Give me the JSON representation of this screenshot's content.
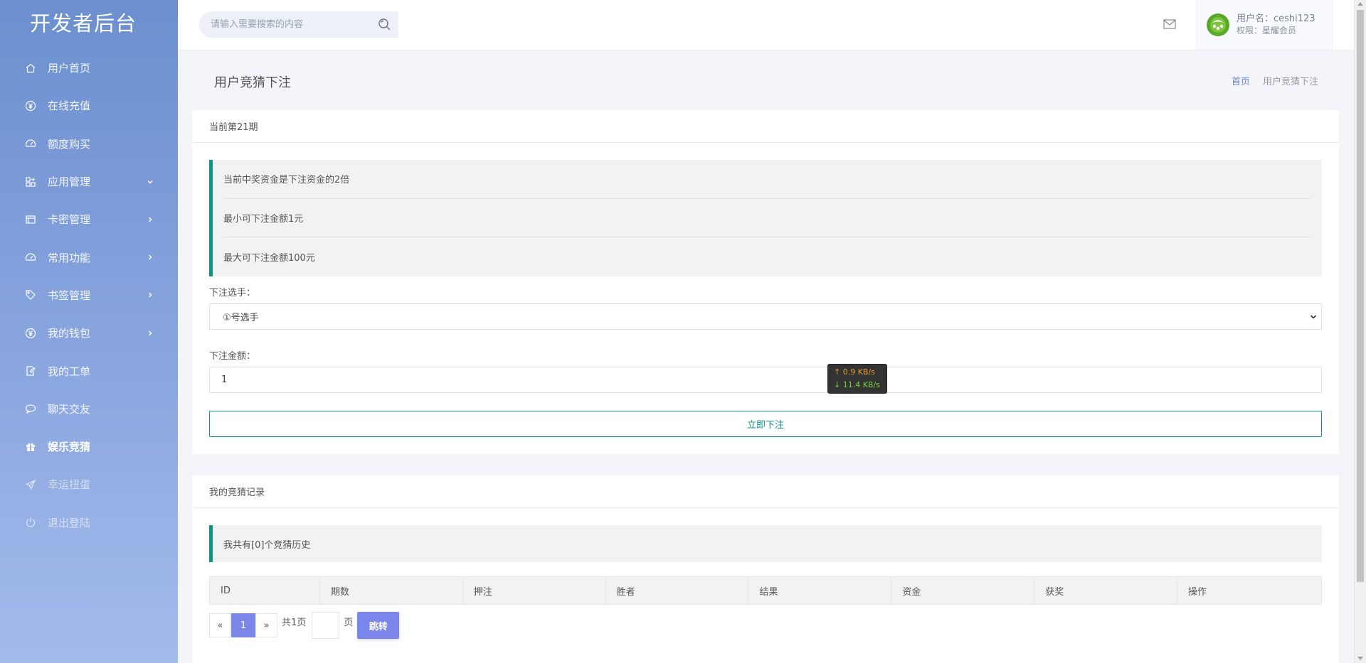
{
  "sidebar": {
    "logo": "开发者后台",
    "items": [
      {
        "label": "用户首页",
        "icon": "home-icon"
      },
      {
        "label": "在线充值",
        "icon": "yen-circle-icon"
      },
      {
        "label": "额度购买",
        "icon": "gauge-icon"
      },
      {
        "label": "应用管理",
        "icon": "apps-icon",
        "chevron": "chevron-down-icon"
      },
      {
        "label": "卡密管理",
        "icon": "card-icon",
        "chevron": "chevron-right-icon"
      },
      {
        "label": "常用功能",
        "icon": "gauge-icon",
        "chevron": "chevron-right-icon"
      },
      {
        "label": "书签管理",
        "icon": "tag-icon",
        "chevron": "chevron-right-icon"
      },
      {
        "label": "我的钱包",
        "icon": "yen-circle-icon",
        "chevron": "chevron-right-icon"
      },
      {
        "label": "我的工单",
        "icon": "edit-doc-icon"
      },
      {
        "label": "聊天交友",
        "icon": "chat-icon"
      },
      {
        "label": "娱乐竞猜",
        "icon": "gift-icon",
        "active": true
      },
      {
        "label": "幸运扭蛋",
        "icon": "paper-plane-icon"
      },
      {
        "label": "退出登陆",
        "icon": "power-icon"
      }
    ]
  },
  "header": {
    "search_placeholder": "请输入需要搜索的内容",
    "user_name": "用户名：ceshi123",
    "user_role": "权限：星耀会员"
  },
  "titlebar": {
    "title": "用户竞猜下注",
    "breadcrumb_home": "首页",
    "breadcrumb_current": "用户竞猜下注"
  },
  "bet_panel": {
    "heading": "当前第21期",
    "notices": [
      "当前中奖资金是下注资金的2倍",
      "最小可下注金额1元",
      "最大可下注金额100元"
    ],
    "player_label": "下注选手：",
    "player_selected": "①号选手",
    "amount_label": "下注金额：",
    "amount_value": "1",
    "submit_label": "立即下注"
  },
  "records_panel": {
    "heading": "我的竞猜记录",
    "summary": "我共有[0]个竞猜历史",
    "columns": [
      "ID",
      "期数",
      "押注",
      "胜者",
      "结果",
      "资金",
      "获奖",
      "操作"
    ],
    "pager": {
      "prev": "«",
      "page": "1",
      "next": "»",
      "total": "共1页",
      "page_unit": "页",
      "go": "跳转"
    }
  },
  "netspeed": {
    "up": "↑ 0.9 KB/s",
    "down": "↓ 11.4 KB/s"
  },
  "colors": {
    "accent_teal": "#119488",
    "accent_purple": "#7b86ea",
    "sidebar_top": "#6b8fcf",
    "sidebar_bottom": "#a4bbec"
  }
}
